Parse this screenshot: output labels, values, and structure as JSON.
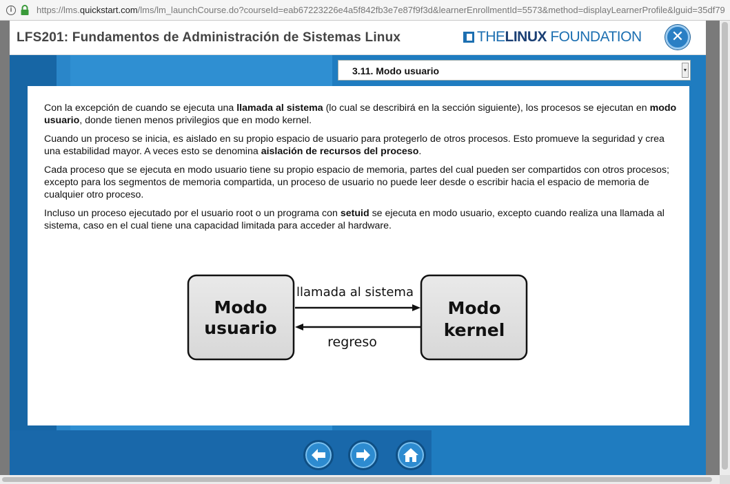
{
  "browser": {
    "url_prefix": "https://lms.",
    "url_host": "quickstart.com",
    "url_rest": "/lms/lm_launchCourse.do?courseId=eab67223226e4a5f842fb3e7e87f9f3d&learnerEnrollmentId=5573&method=displayLearnerProfile&lguid=35df79"
  },
  "header": {
    "course_title": "LFS201: Fundamentos de Administración de Sistemas Linux",
    "logo_the": "THE",
    "logo_linux": "LINUX",
    "logo_foundation": "FOUNDATION",
    "close_symbol": "✕"
  },
  "lesson_select": {
    "selected": "3.11. Modo usuario"
  },
  "content": {
    "p1": [
      {
        "t": "Con la excepción de cuando se ejecuta una ",
        "b": false
      },
      {
        "t": "llamada al sistema",
        "b": true
      },
      {
        "t": " (lo cual se describirá en la sección siguiente), los procesos se ejecutan en ",
        "b": false
      },
      {
        "t": "modo usuario",
        "b": true
      },
      {
        "t": ", donde tienen menos privilegios que en modo kernel.",
        "b": false
      }
    ],
    "p2": [
      {
        "t": "Cuando un proceso se inicia, es aislado en su propio espacio de usuario para protegerlo de otros procesos. Esto promueve la seguridad y crea una estabilidad mayor. A veces esto se denomina ",
        "b": false
      },
      {
        "t": "aislación de recursos del proceso",
        "b": true
      },
      {
        "t": ".",
        "b": false
      }
    ],
    "p3": [
      {
        "t": "Cada proceso que se ejecuta en modo usuario tiene su propio espacio de memoria, partes del cual pueden ser compartidos con otros procesos; excepto para los segmentos de memoria compartida, un proceso de usuario no puede leer desde o escribir hacia el espacio de memoria de cualquier otro proceso.",
        "b": false
      }
    ],
    "p4": [
      {
        "t": "Incluso un proceso ejecutado por el usuario root o un programa con ",
        "b": false
      },
      {
        "t": "setuid",
        "b": true
      },
      {
        "t": " se ejecuta en modo usuario, excepto cuando realiza una llamada al sistema, caso en el cual tiene una capacidad limitada para acceder al hardware.",
        "b": false
      }
    ]
  },
  "diagram": {
    "left_box_line1": "Modo",
    "left_box_line2": "usuario",
    "right_box_line1": "Modo",
    "right_box_line2": "kernel",
    "top_arrow_label": "llamada al sistema",
    "bottom_arrow_label": "regreso"
  },
  "nav": {
    "back_icon": "arrow-left",
    "forward_icon": "arrow-right",
    "home_icon": "home"
  },
  "colors": {
    "brand_blue": "#1c6fb1",
    "stage_blue": "#1b73b7"
  }
}
